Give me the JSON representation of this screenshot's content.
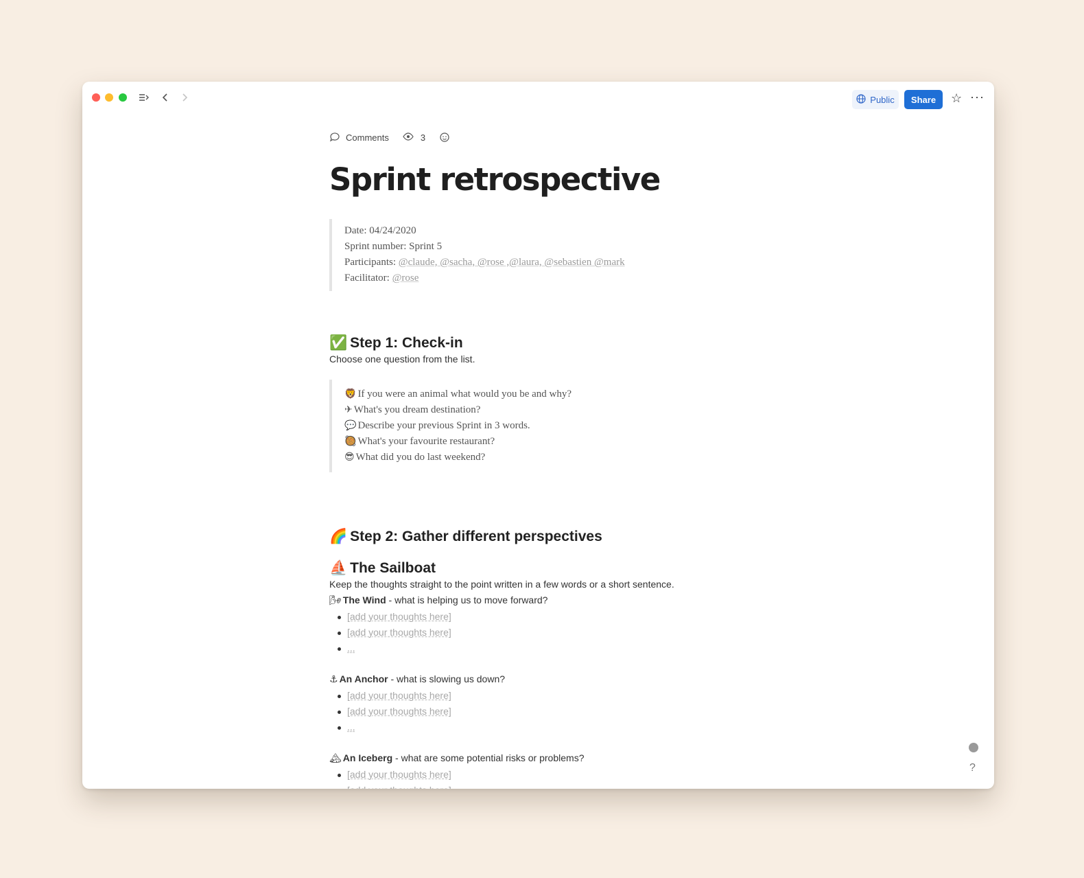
{
  "toolbar": {
    "public_label": "Public",
    "share_label": "Share"
  },
  "meta_bar": {
    "comments_label": "Comments",
    "views_count": "3"
  },
  "page": {
    "title": "Sprint retrospective"
  },
  "info": {
    "date": "Date: 04/24/2020",
    "sprint": "Sprint number: Sprint 5",
    "participants_label": "Participants: ",
    "participants": "@claude, @sacha, @rose ,@laura, @sebastien @mark",
    "facilitator_label": "Facilitator: ",
    "facilitator": "@rose"
  },
  "step1": {
    "emoji": "✅",
    "heading": "Step 1: Check-in",
    "intro": "Choose one question from the list.",
    "questions": [
      {
        "emoji": "🦁",
        "text": "If you were an animal what would you be and why?"
      },
      {
        "emoji": "✈",
        "text": "What's you dream destination?"
      },
      {
        "emoji": "💬",
        "text": "Describe your previous Sprint in 3 words."
      },
      {
        "emoji": "🥘",
        "text": "What's your favourite restaurant?"
      },
      {
        "emoji": "😎",
        "text": "What did you do last weekend?"
      }
    ]
  },
  "step2": {
    "emoji": "🌈",
    "heading": "Step 2: Gather different perspectives",
    "sailboat_emoji": "⛵",
    "sailboat_heading": "The Sailboat",
    "intro": "Keep the thoughts straight to the point written in a few words or a short sentence.",
    "wind": {
      "emoji": "🌬",
      "title": "The Wind",
      "desc": " - what is helping us to move forward?"
    },
    "anchor": {
      "emoji": "⚓",
      "title": "An Anchor",
      "desc": " - what is slowing us down?"
    },
    "iceberg": {
      "emoji": "🏔",
      "title": "An Iceberg",
      "desc": " - what are some potential risks or problems?"
    },
    "placeholder": "[add your thoughts here]",
    "ellipsis": "..."
  },
  "help_label": "?"
}
